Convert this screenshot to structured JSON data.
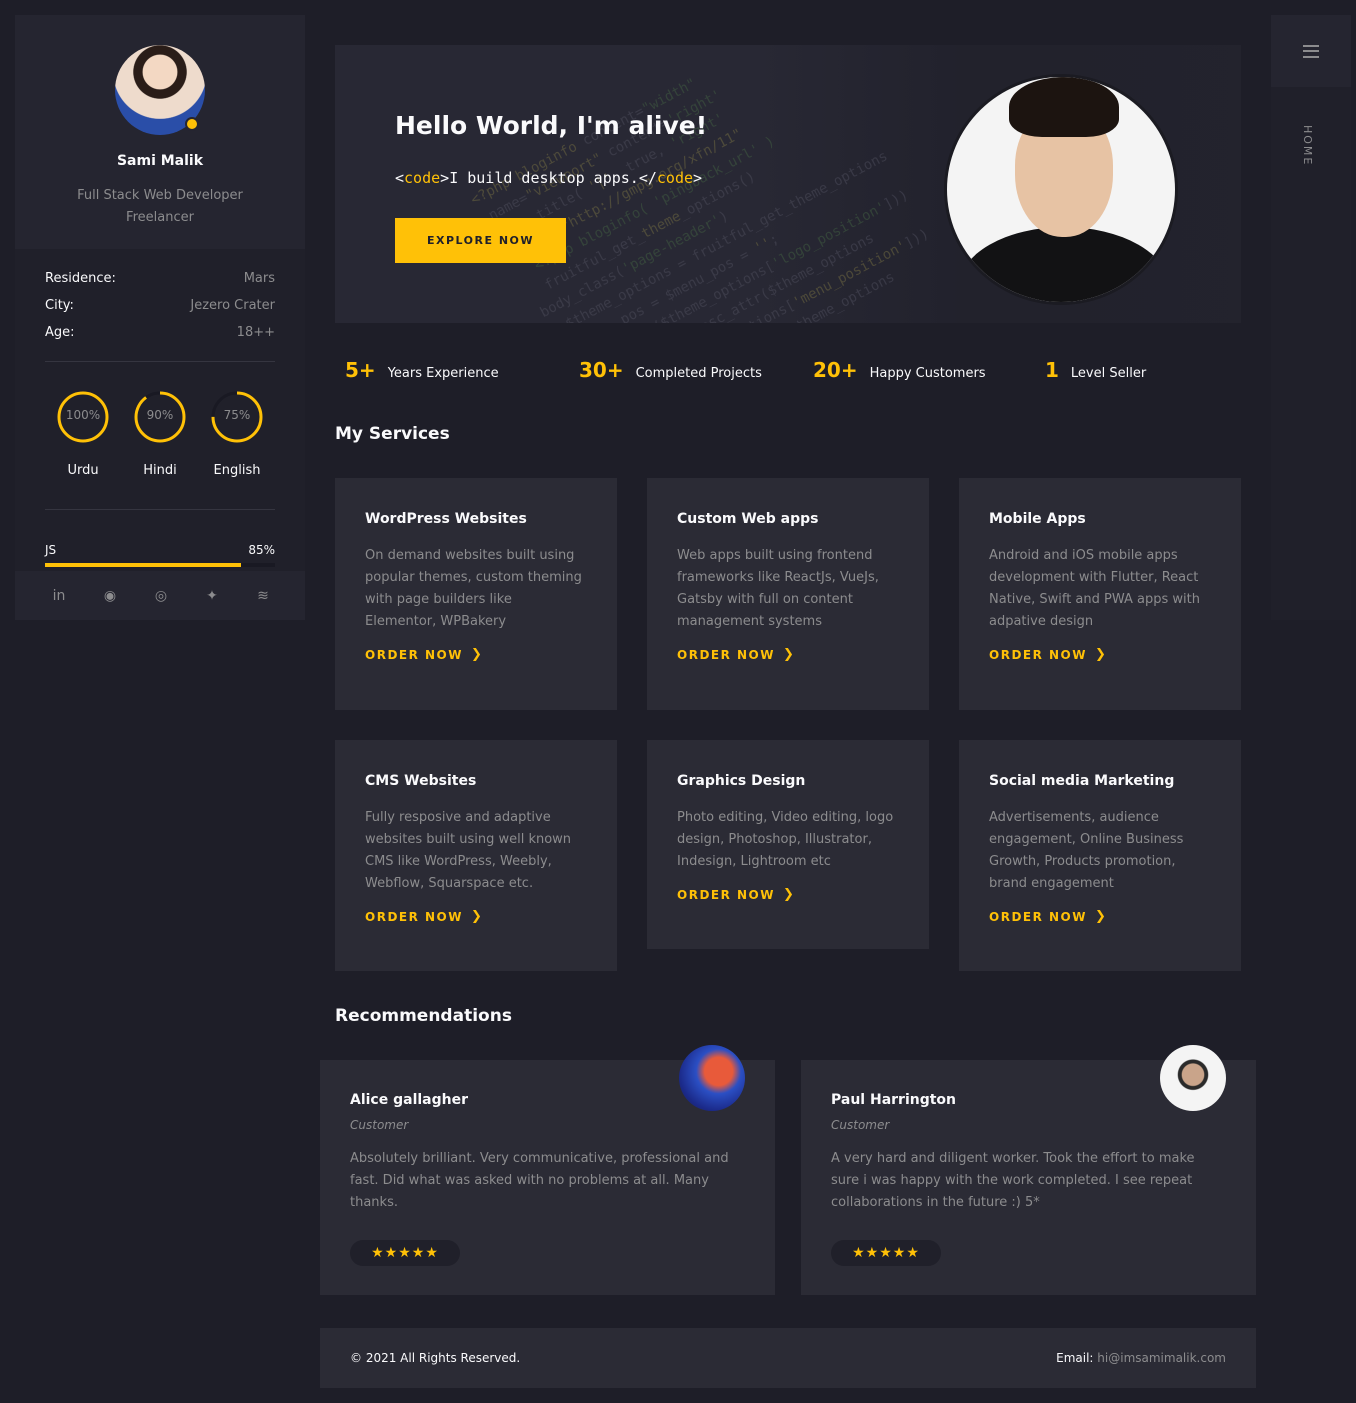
{
  "profile": {
    "name": "Sami Malik",
    "role_line1": "Full Stack Web Developer",
    "role_line2": "Freelancer"
  },
  "info": [
    {
      "label": "Residence:",
      "value": "Mars"
    },
    {
      "label": "City:",
      "value": "Jezero Crater"
    },
    {
      "label": "Age:",
      "value": "18++"
    }
  ],
  "languages": [
    {
      "name": "Urdu",
      "percent_text": "100%",
      "percent": 100
    },
    {
      "name": "Hindi",
      "percent_text": "90%",
      "percent": 90
    },
    {
      "name": "English",
      "percent_text": "75%",
      "percent": 75
    }
  ],
  "skills": [
    {
      "name": "JS",
      "percent_text": "85%",
      "percent": 85
    }
  ],
  "social": [
    {
      "icon": "linkedin-icon",
      "glyph": "in"
    },
    {
      "icon": "github-icon",
      "glyph": "◉"
    },
    {
      "icon": "instagram-icon",
      "glyph": "◎"
    },
    {
      "icon": "twitter-icon",
      "glyph": "✦"
    },
    {
      "icon": "stackoverflow-icon",
      "glyph": "≋"
    }
  ],
  "rightbar": {
    "menu_icon": "hamburger-icon",
    "current_page": "HOME"
  },
  "hero": {
    "title": "Hello World, I'm alive!",
    "code_open_lt": "<",
    "code_open_tag": "code",
    "code_open_gt": ">",
    "code_text": "I build desktop apps.",
    "code_close_lt": "</",
    "code_close_tag": "code",
    "code_close_gt": ">",
    "button": "EXPLORE NOW"
  },
  "stats": [
    {
      "num": "5+",
      "label": "Years Experience"
    },
    {
      "num": "30+",
      "label": "Completed Projects"
    },
    {
      "num": "20+",
      "label": "Happy Customers"
    },
    {
      "num": "1",
      "label": "Level Seller"
    }
  ],
  "services_title": "My Services",
  "services": [
    {
      "title": "WordPress Websites",
      "desc": "On demand websites built using popular themes, custom theming with page builders like Elementor, WPBakery",
      "cta": "ORDER NOW"
    },
    {
      "title": "Custom Web apps",
      "desc": "Web apps built using frontend frameworks like ReactJs, VueJs, Gatsby with full on content management systems",
      "cta": "ORDER NOW"
    },
    {
      "title": "Mobile Apps",
      "desc": "Android and iOS mobile apps development with Flutter, React Native, Swift and PWA apps with adpative design",
      "cta": "ORDER NOW"
    },
    {
      "title": "CMS Websites",
      "desc": "Fully resposive and adaptive websites built using well known CMS like WordPress, Weebly, Webflow, Squarspace etc.",
      "cta": "ORDER NOW"
    },
    {
      "title": "Graphics Design",
      "desc": "Photo editing, Video editing, logo design, Photoshop, Illustrator, Indesign, Lightroom etc",
      "cta": "ORDER NOW"
    },
    {
      "title": "Social media Marketing",
      "desc": "Advertisements, audience engagement, Online Business Growth, Products promotion, brand engagement",
      "cta": "ORDER NOW"
    }
  ],
  "recommendations_title": "Recommendations",
  "recommendations": [
    {
      "name": "Alice gallagher",
      "role": "Customer",
      "text": "Absolutely brilliant. Very communicative, professional and fast. Did what was asked with no problems at all. Many thanks.",
      "stars": "★★★★★",
      "rating": 5
    },
    {
      "name": "Paul Harrington",
      "role": "Customer",
      "text": "A very hard and diligent worker. Took the effort to make sure i was happy with the work completed. I see repeat collaborations in the future :) 5*",
      "stars": "★★★★★",
      "rating": 5
    }
  ],
  "footer": {
    "copyright": "© 2021 All Rights Reserved.",
    "email_label": "Email:",
    "email_value": "hi@imsamimalik.com"
  },
  "colors": {
    "accent": "#ffc107",
    "background": "#1e1e28",
    "card": "#2b2b35",
    "text_light": "#fafafc",
    "text_muted": "#8c8c8e"
  }
}
